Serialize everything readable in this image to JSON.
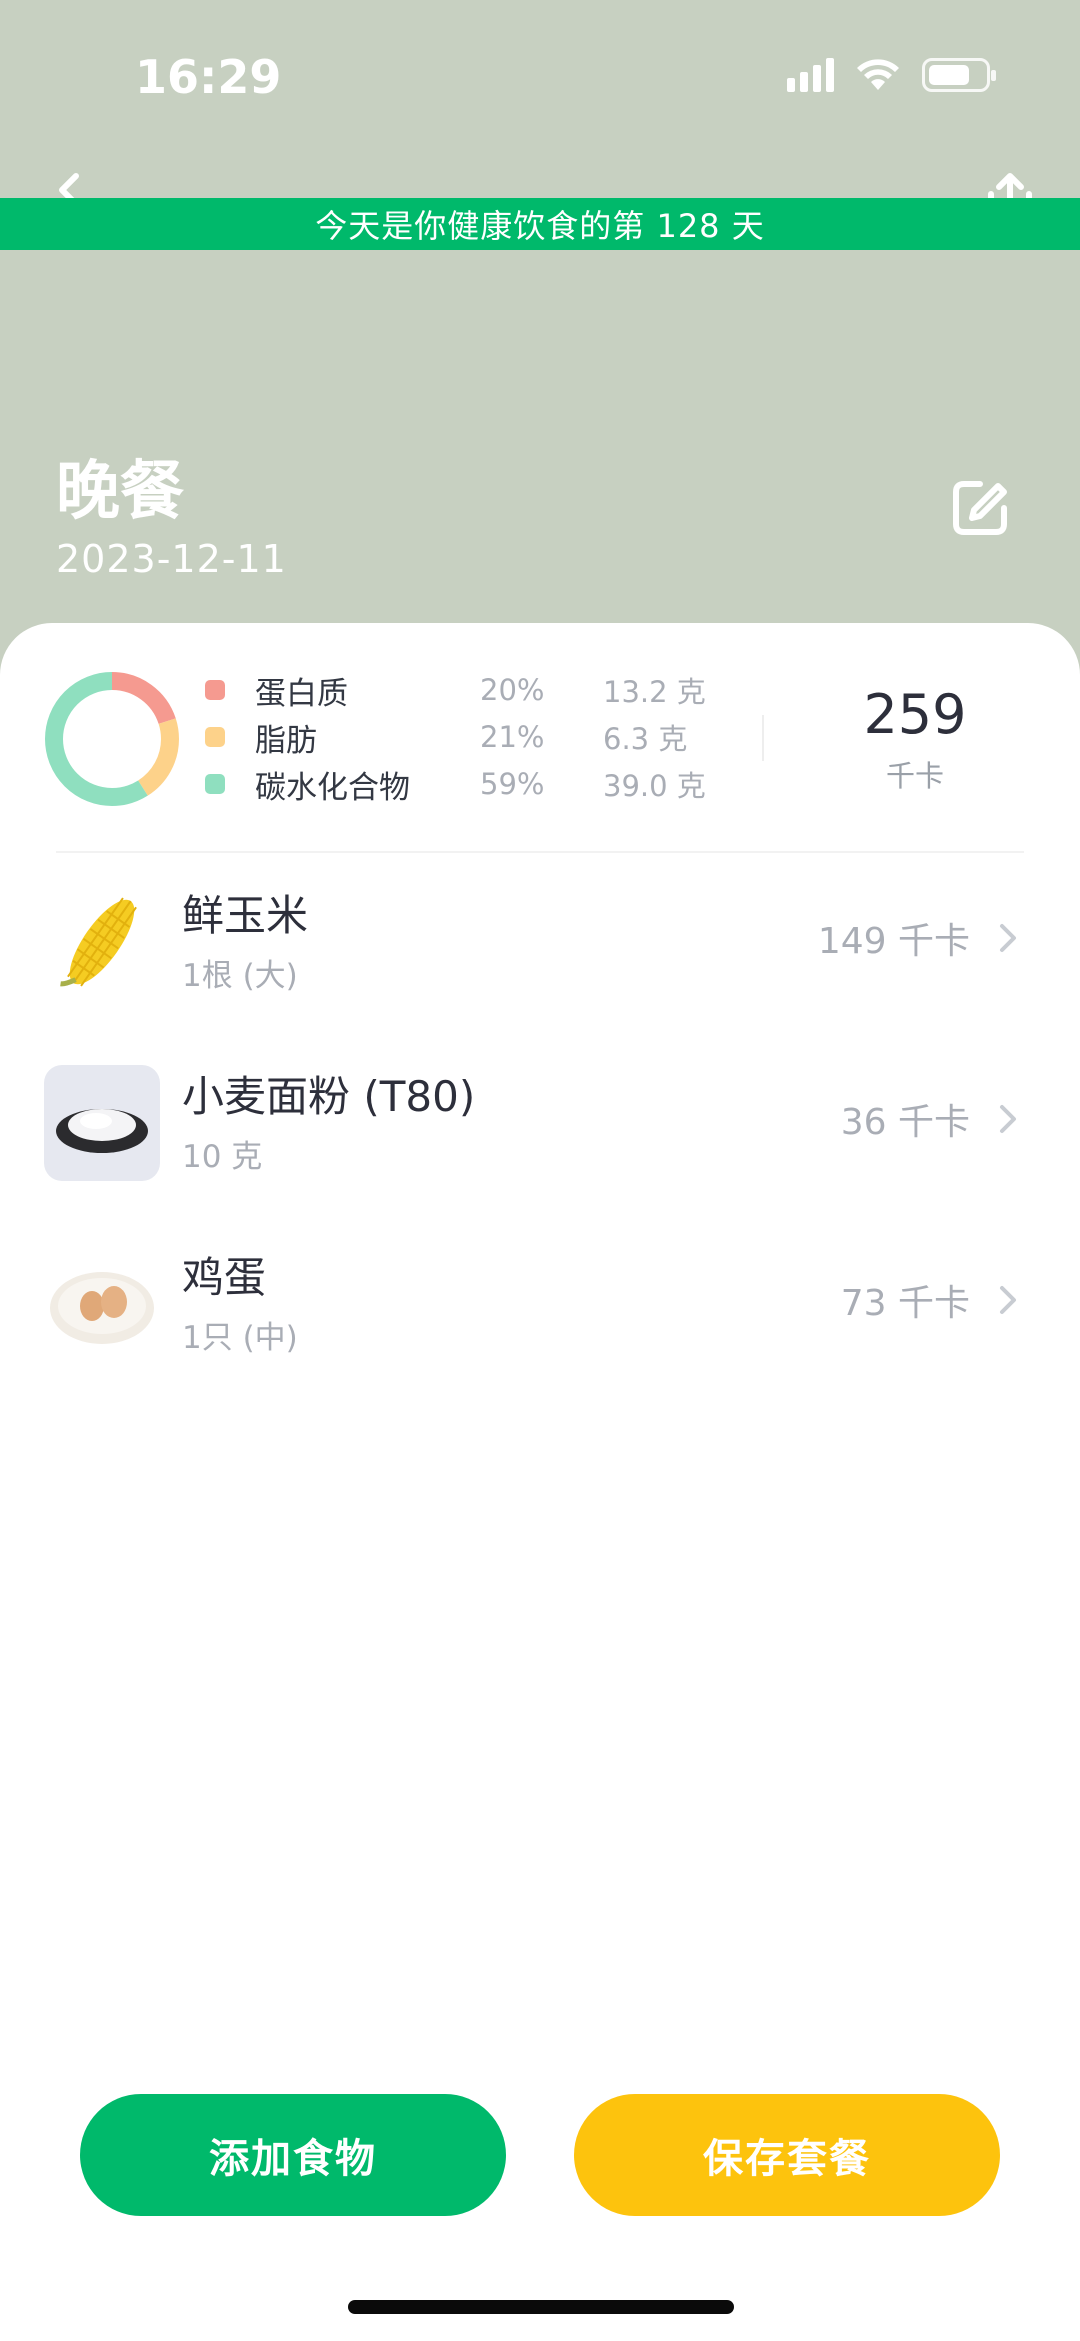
{
  "status": {
    "time": "16:29"
  },
  "banner": {
    "text": "今天是你健康饮食的第 128 天"
  },
  "header": {
    "title": "晚餐",
    "date": "2023-12-11"
  },
  "nutrition": {
    "macros": [
      {
        "name": "蛋白质",
        "percent": "20%",
        "grams": "13.2 克",
        "color": "#f59a90",
        "fraction": 0.2
      },
      {
        "name": "脂肪",
        "percent": "21%",
        "grams": "6.3 克",
        "color": "#fdd28a",
        "fraction": 0.21
      },
      {
        "name": "碳水化合物",
        "percent": "59%",
        "grams": "39.0 克",
        "color": "#8fdfbf",
        "fraction": 0.59
      }
    ],
    "total_kcal": "259",
    "kcal_unit": "千卡"
  },
  "foods": [
    {
      "name": "鲜玉米",
      "portion": "1根 (大)",
      "kcal": "149 千卡",
      "icon": "corn"
    },
    {
      "name": "小麦面粉 (T80)",
      "portion": "10 克",
      "kcal": "36 千卡",
      "icon": "flour"
    },
    {
      "name": "鸡蛋",
      "portion": "1只 (中)",
      "kcal": "73 千卡",
      "icon": "eggs"
    }
  ],
  "buttons": {
    "add": "添加食物",
    "save": "保存套餐"
  },
  "colors": {
    "brand_green": "#00b96b",
    "accent_yellow": "#fdc30d",
    "header_bg": "#c7d0c1"
  }
}
